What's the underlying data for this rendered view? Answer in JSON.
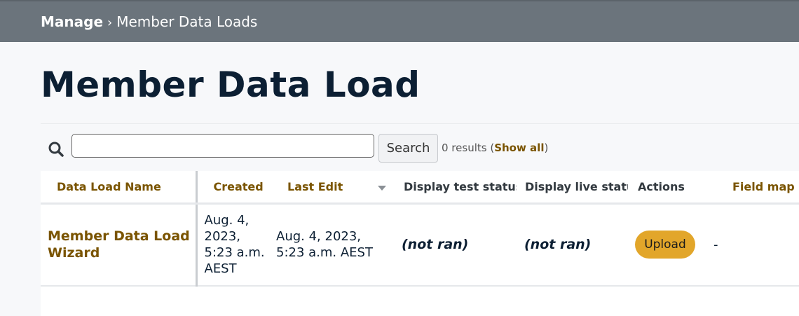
{
  "breadcrumb": {
    "root": "Manage",
    "separator": "›",
    "current": "Member Data Loads"
  },
  "page_title": "Member Data Load",
  "search": {
    "value": "",
    "button_label": "Search",
    "results_prefix": "0 results (",
    "show_all_label": "Show all",
    "results_suffix": ")",
    "icon": "search-icon"
  },
  "table": {
    "headers": {
      "name": "Data Load Name",
      "created": "Created",
      "last_edit": "Last Edit",
      "test_status": "Display test status",
      "live_status": "Display live status",
      "actions": "Actions",
      "field_map": "Field map"
    },
    "rows": [
      {
        "name": "Member Data Load Wizard",
        "created": "Aug. 4, 2023, 5:23 a.m. AEST",
        "last_edit": "Aug. 4, 2023, 5:23 a.m. AEST",
        "test_status": "(not ran)",
        "live_status": "(not ran)",
        "action_label": "Upload",
        "field_map": "-"
      }
    ]
  },
  "colors": {
    "topbar": "#6b747c",
    "link": "#7a5400",
    "upload_button": "#e2a62a",
    "title": "#0c1f33"
  }
}
